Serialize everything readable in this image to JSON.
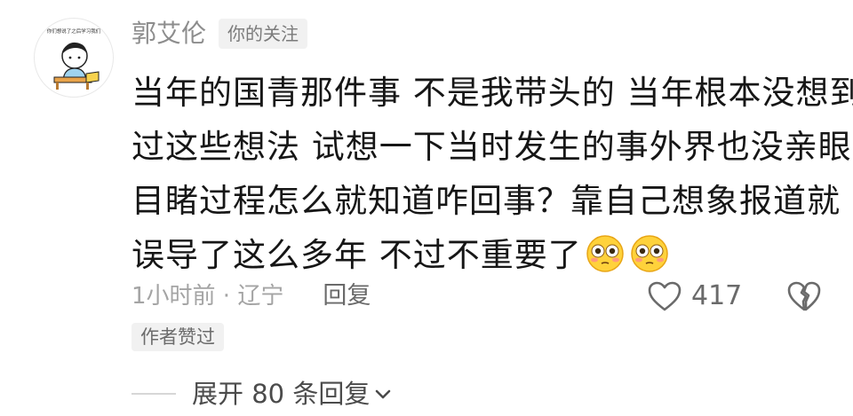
{
  "user": {
    "name": "郭艾伦",
    "badge": "你的关注",
    "avatar_caption": "你们想说了之后学习我们"
  },
  "comment": {
    "lines": [
      "当年的国青那件事 不是我带头的 当年根本没想到",
      "过这些想法 试想一下当时发生的事外界也没亲眼",
      "目睹过程怎么就知道咋回事？靠自己想象报道就",
      "误导了这么多年  不过不重要了"
    ],
    "emojis": [
      "flushed-face-emoji",
      "flushed-face-emoji"
    ]
  },
  "meta": {
    "time_location": "1小时前 · 辽宁",
    "reply_label": "回复",
    "like_count": "417",
    "author_liked": "作者赞过"
  },
  "replies": {
    "expand_label": "展开 80 条回复"
  },
  "icons": {
    "like": "heart-outline-icon",
    "dislike": "broken-heart-icon",
    "expand": "chevron-down-icon"
  },
  "colors": {
    "text": "#161616",
    "muted": "#a4a4a4",
    "badge_bg": "#f1f1f1"
  }
}
